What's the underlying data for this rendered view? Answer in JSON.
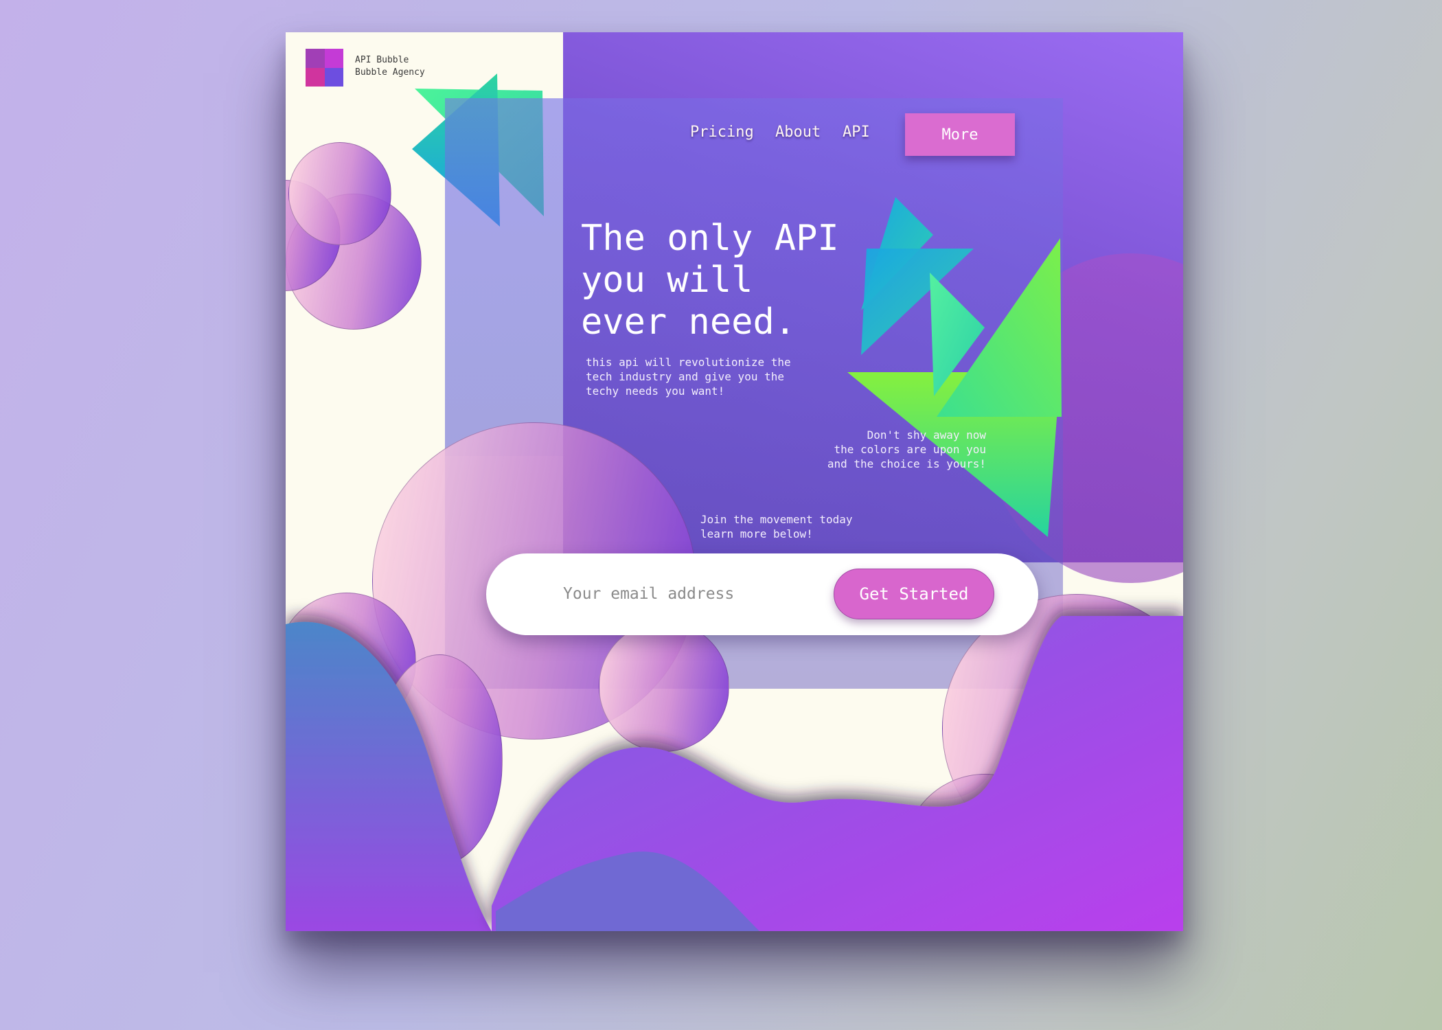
{
  "brand": {
    "logo_icon": "grid-logo-icon",
    "name": "API Bubble",
    "agency": "Bubble Agency"
  },
  "nav": {
    "items": [
      {
        "label": "Pricing"
      },
      {
        "label": "About"
      },
      {
        "label": "API"
      }
    ],
    "more_label": "More"
  },
  "hero": {
    "headline_line1": "The only API",
    "headline_line2": "you will",
    "headline_line3": "ever need.",
    "description": "this api will revolutionize the\ntech industry and give you the\ntechy needs you want!",
    "tagline": "Don't shy away now\nthe colors are upon you\nand the choice is yours!",
    "call_out": "Join the movement today\n learn more below!"
  },
  "signup": {
    "email_placeholder": "Your email address",
    "email_value": "",
    "button_label": "Get Started"
  },
  "colors": {
    "accent_pink": "#da6cd0",
    "purple": "#7d55d6",
    "triangle_green": "#4cf09a",
    "triangle_blue": "#18a0e6",
    "cream": "#fdfbef"
  }
}
